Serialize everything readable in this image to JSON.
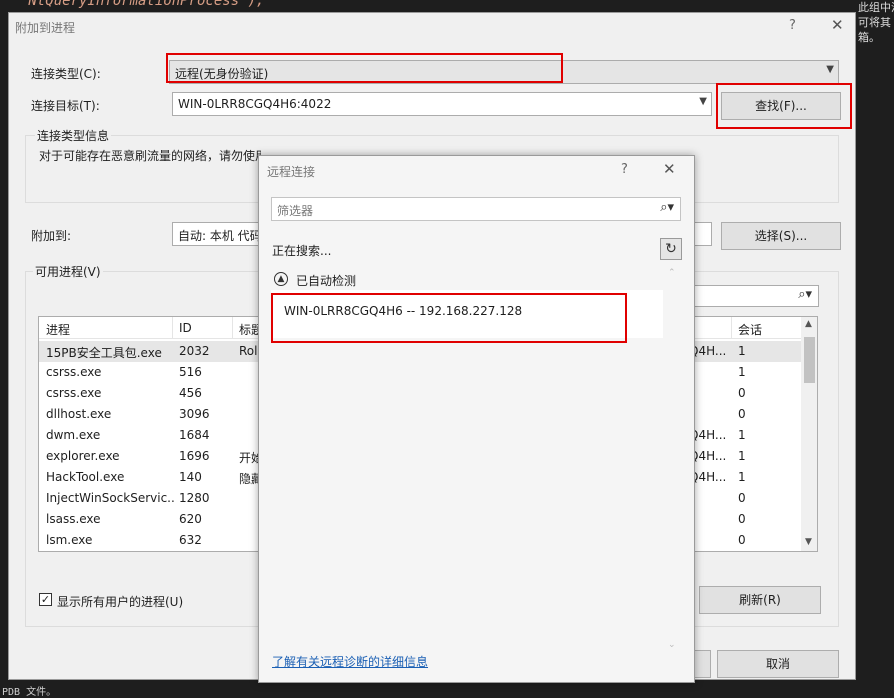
{
  "ide": {
    "code_line": "\"NtQueryInformationProcess\");",
    "right_text": "此组中没有可用的扩\n可将其\n箱。",
    "bottom_text": "PDB 文件。"
  },
  "dialog": {
    "title": "附加到进程",
    "help": "?",
    "close": "✕",
    "connection_type_label": "连接类型(C):",
    "connection_type_value": "远程(无身份验证)",
    "connection_target_label": "连接目标(T):",
    "connection_target_value": "WIN-0LRR8CGQ4H6:4022",
    "find_button": "查找(F)...",
    "info_group_label": "连接类型信息",
    "info_text": "对于可能存在恶意刷流量的网络，请勿使用“远程(无身份验证)”连接，请尽可能使用“默认”连接。",
    "attach_to_label": "附加到:",
    "attach_to_value": "自动: 本机 代码",
    "select_button": "选择(S)...",
    "available_label": "可用进程(V)",
    "table": {
      "columns": [
        "进程",
        "ID",
        "标题",
        "会话"
      ],
      "rows": [
        {
          "name": "15PB安全工具包.exe",
          "id": "2032",
          "title": "Rol",
          "user": "Q4H...",
          "session": "1"
        },
        {
          "name": "csrss.exe",
          "id": "516",
          "title": "",
          "user": "",
          "session": "1"
        },
        {
          "name": "csrss.exe",
          "id": "456",
          "title": "",
          "user": "",
          "session": "0"
        },
        {
          "name": "dllhost.exe",
          "id": "3096",
          "title": "",
          "user": "",
          "session": "0"
        },
        {
          "name": "dwm.exe",
          "id": "1684",
          "title": "",
          "user": "Q4H...",
          "session": "1"
        },
        {
          "name": "explorer.exe",
          "id": "1696",
          "title": "开始",
          "user": "Q4H...",
          "session": "1"
        },
        {
          "name": "HackTool.exe",
          "id": "140",
          "title": "隐藏",
          "user": "Q4H...",
          "session": "1"
        },
        {
          "name": "InjectWinSockServic...",
          "id": "1280",
          "title": "",
          "user": "",
          "session": "0"
        },
        {
          "name": "lsass.exe",
          "id": "620",
          "title": "",
          "user": "",
          "session": "0"
        },
        {
          "name": "lsm.exe",
          "id": "632",
          "title": "",
          "user": "",
          "session": "0"
        }
      ]
    },
    "show_all_users_label": "显示所有用户的进程(U)",
    "show_all_users_checked": true,
    "refresh_button": "刷新(R)",
    "cancel_button": "取消"
  },
  "remote": {
    "title": "远程连接",
    "help": "?",
    "close": "✕",
    "filter_placeholder": "筛选器",
    "searching_text": "正在搜索...",
    "auto_detected_label": "已自动检测",
    "hosts": [
      "WIN-0LRR8CGQ4H6 -- 192.168.227.128"
    ],
    "details_link": "了解有关远程诊断的详细信息"
  },
  "colors": {
    "highlight_red": "#e00000",
    "link_blue": "#1a5fb4",
    "dialog_bg": "#f0f0f0"
  },
  "icons": {
    "search": "search-icon",
    "refresh": "refresh-icon",
    "collapse": "chevron-up-icon",
    "dropdown": "chevron-down-icon"
  }
}
